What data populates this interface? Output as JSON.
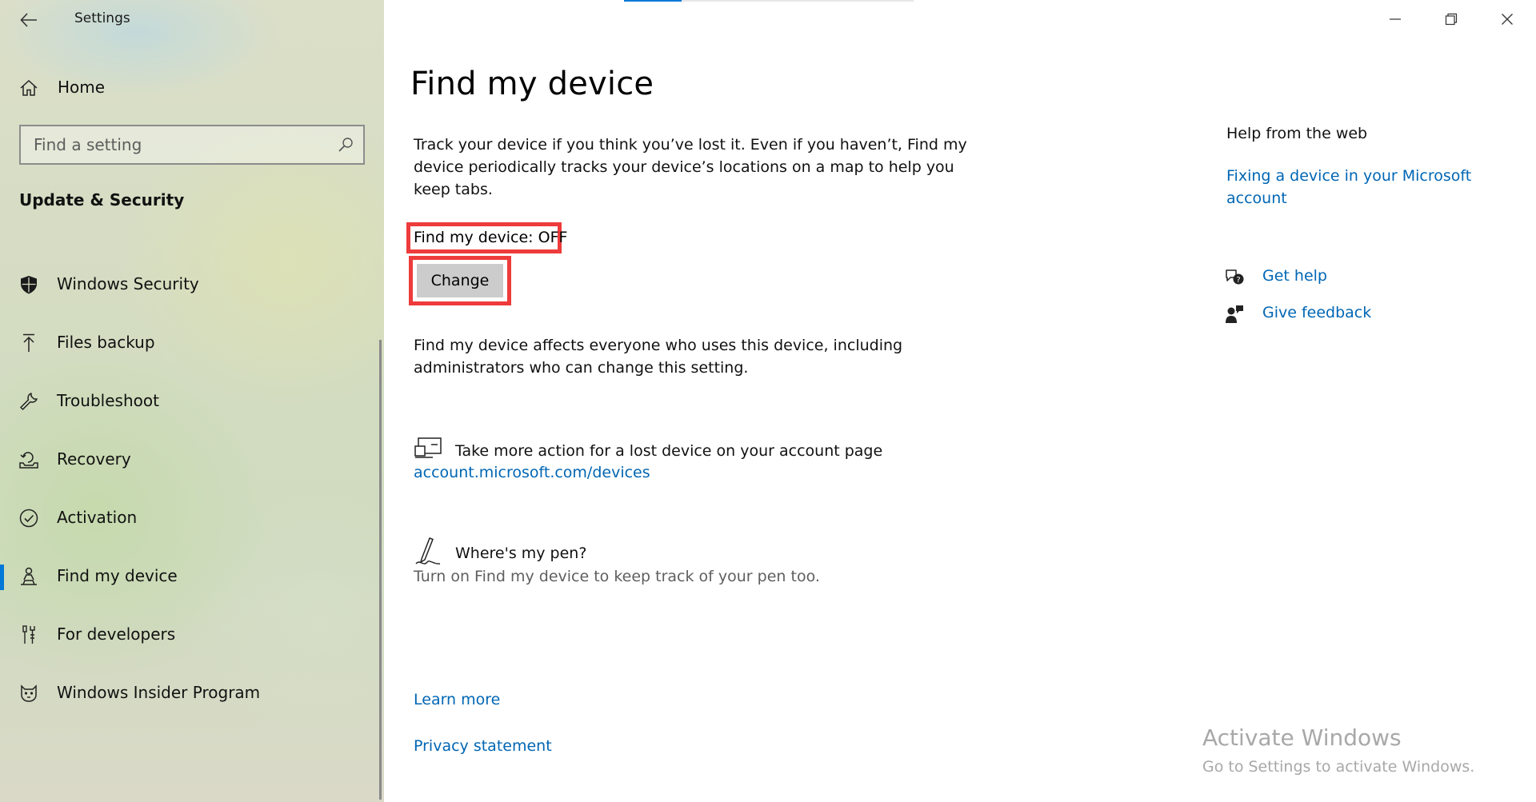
{
  "window": {
    "title": "Settings",
    "controls": [
      "minimize",
      "restore",
      "close"
    ]
  },
  "sidebar": {
    "home_label": "Home",
    "search_placeholder": "Find a setting",
    "section_title": "Update & Security",
    "items": [
      {
        "label": "Windows Security",
        "icon": "shield-icon"
      },
      {
        "label": "Files backup",
        "icon": "upload-arrow-icon"
      },
      {
        "label": "Troubleshoot",
        "icon": "wrench-icon"
      },
      {
        "label": "Recovery",
        "icon": "recovery-icon"
      },
      {
        "label": "Activation",
        "icon": "checkmark-circle-icon"
      },
      {
        "label": "Find my device",
        "icon": "person-location-icon",
        "selected": true
      },
      {
        "label": "For developers",
        "icon": "developer-tools-icon"
      },
      {
        "label": "Windows Insider Program",
        "icon": "insider-cat-icon"
      }
    ]
  },
  "main": {
    "title": "Find my device",
    "description": "Track your device if you think you’ve lost it. Even if you haven’t, Find my device periodically tracks your device’s locations on a map to help you keep tabs.",
    "status_label": "Find my device: OFF",
    "change_button": "Change",
    "affects_note": "Find my device affects everyone who uses this device, including administrators who can change this setting.",
    "account_action": {
      "title": "Take more action for a lost device on your account page",
      "link": "account.microsoft.com/devices"
    },
    "pen": {
      "title": "Where's my pen?",
      "subtitle": "Turn on Find my device to keep track of your pen too."
    },
    "learn_more": "Learn more",
    "privacy_statement": "Privacy statement"
  },
  "help": {
    "title": "Help from the web",
    "link": "Fixing a device in your Microsoft account",
    "get_help": "Get help",
    "give_feedback": "Give feedback"
  },
  "watermark": {
    "title": "Activate Windows",
    "subtitle": "Go to Settings to activate Windows."
  },
  "colors": {
    "accent": "#0078d7",
    "link": "#0066b4",
    "highlight": "#ee3b3b",
    "button": "#cccccc"
  }
}
